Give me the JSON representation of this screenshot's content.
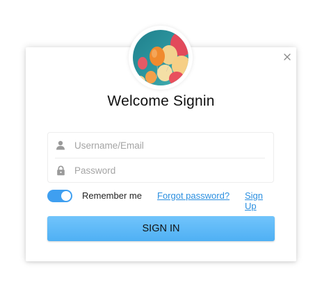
{
  "dialog": {
    "title": "Welcome Signin",
    "close_icon": "close-icon",
    "avatar_icon": "balloons-avatar"
  },
  "form": {
    "username": {
      "placeholder": "Username/Email",
      "value": "",
      "icon": "user-icon"
    },
    "password": {
      "placeholder": "Password",
      "value": "",
      "icon": "lock-icon"
    }
  },
  "options": {
    "remember_label": "Remember me",
    "remember_on": true,
    "forgot_label": "Forgot password?",
    "signup_label": "Sign Up"
  },
  "submit": {
    "label": "SIGN IN"
  },
  "colors": {
    "accent": "#3f9ff0",
    "link": "#2b8fe0",
    "button_top": "#71c4fb",
    "button_bottom": "#4fb0f4"
  }
}
